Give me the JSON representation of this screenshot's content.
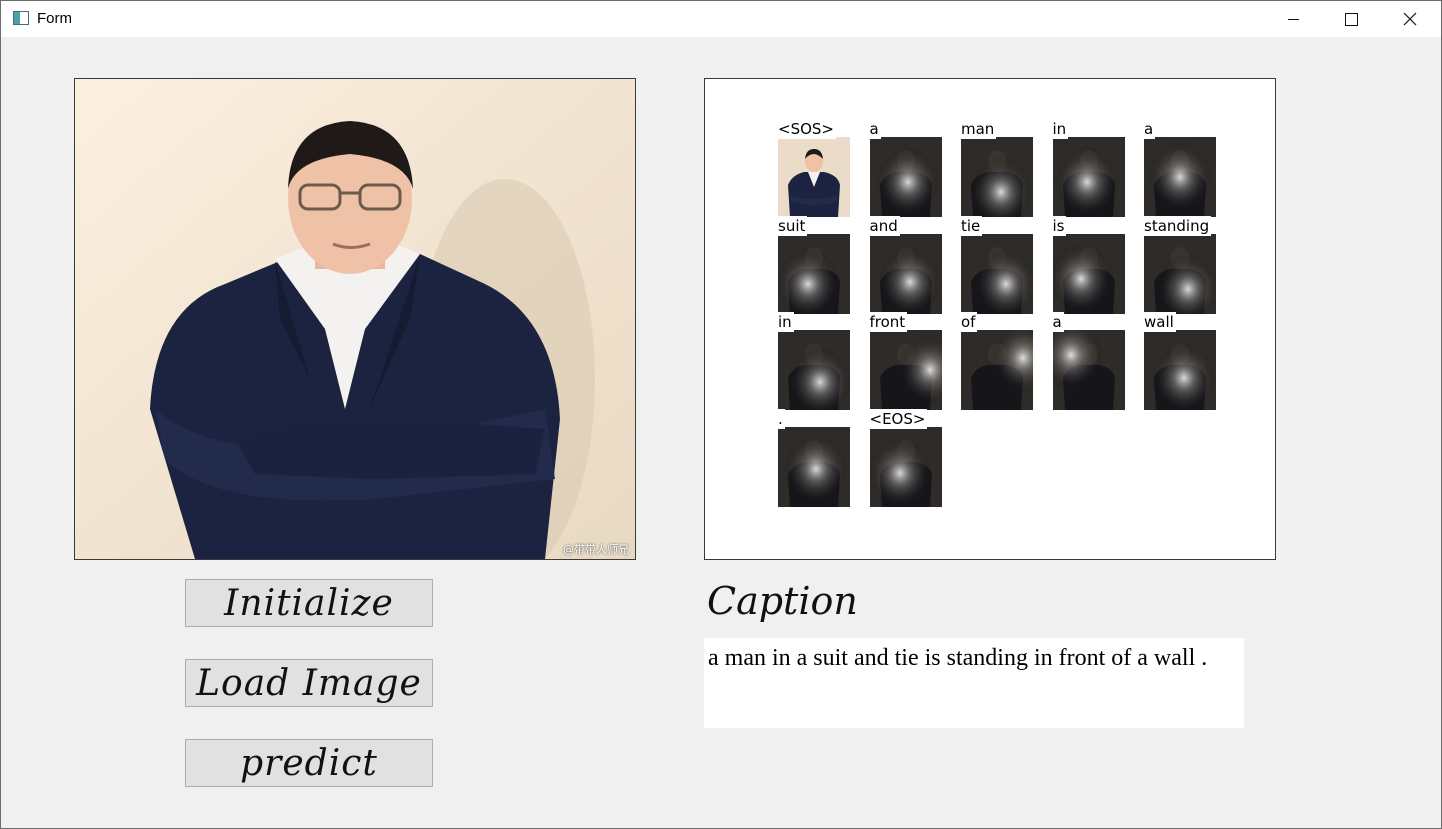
{
  "window": {
    "title": "Form"
  },
  "photo": {
    "watermark": "@带带人师兄"
  },
  "attention": {
    "tiles": [
      {
        "word": "<SOS>",
        "type": "original"
      },
      {
        "word": "a",
        "type": "attn"
      },
      {
        "word": "man",
        "type": "attn"
      },
      {
        "word": "in",
        "type": "attn"
      },
      {
        "word": "a",
        "type": "attn"
      },
      {
        "word": "suit",
        "type": "attn"
      },
      {
        "word": "and",
        "type": "attn"
      },
      {
        "word": "tie",
        "type": "attn"
      },
      {
        "word": "is",
        "type": "attn"
      },
      {
        "word": "standing",
        "type": "attn"
      },
      {
        "word": "in",
        "type": "attn"
      },
      {
        "word": "front",
        "type": "attn"
      },
      {
        "word": "of",
        "type": "attn"
      },
      {
        "word": "a",
        "type": "attn"
      },
      {
        "word": "wall",
        "type": "attn"
      },
      {
        "word": ".",
        "type": "attn"
      },
      {
        "word": "<EOS>",
        "type": "attn"
      }
    ]
  },
  "buttons": {
    "initialize": "Initialize",
    "load_image": "Load Image",
    "predict": "predict"
  },
  "caption": {
    "label": "Caption",
    "text": "a man in a suit and tie is standing in front of a wall ."
  },
  "icons": {
    "app": "app-window-icon",
    "minimize": "minimize-icon",
    "maximize": "maximize-icon",
    "close": "close-icon"
  }
}
